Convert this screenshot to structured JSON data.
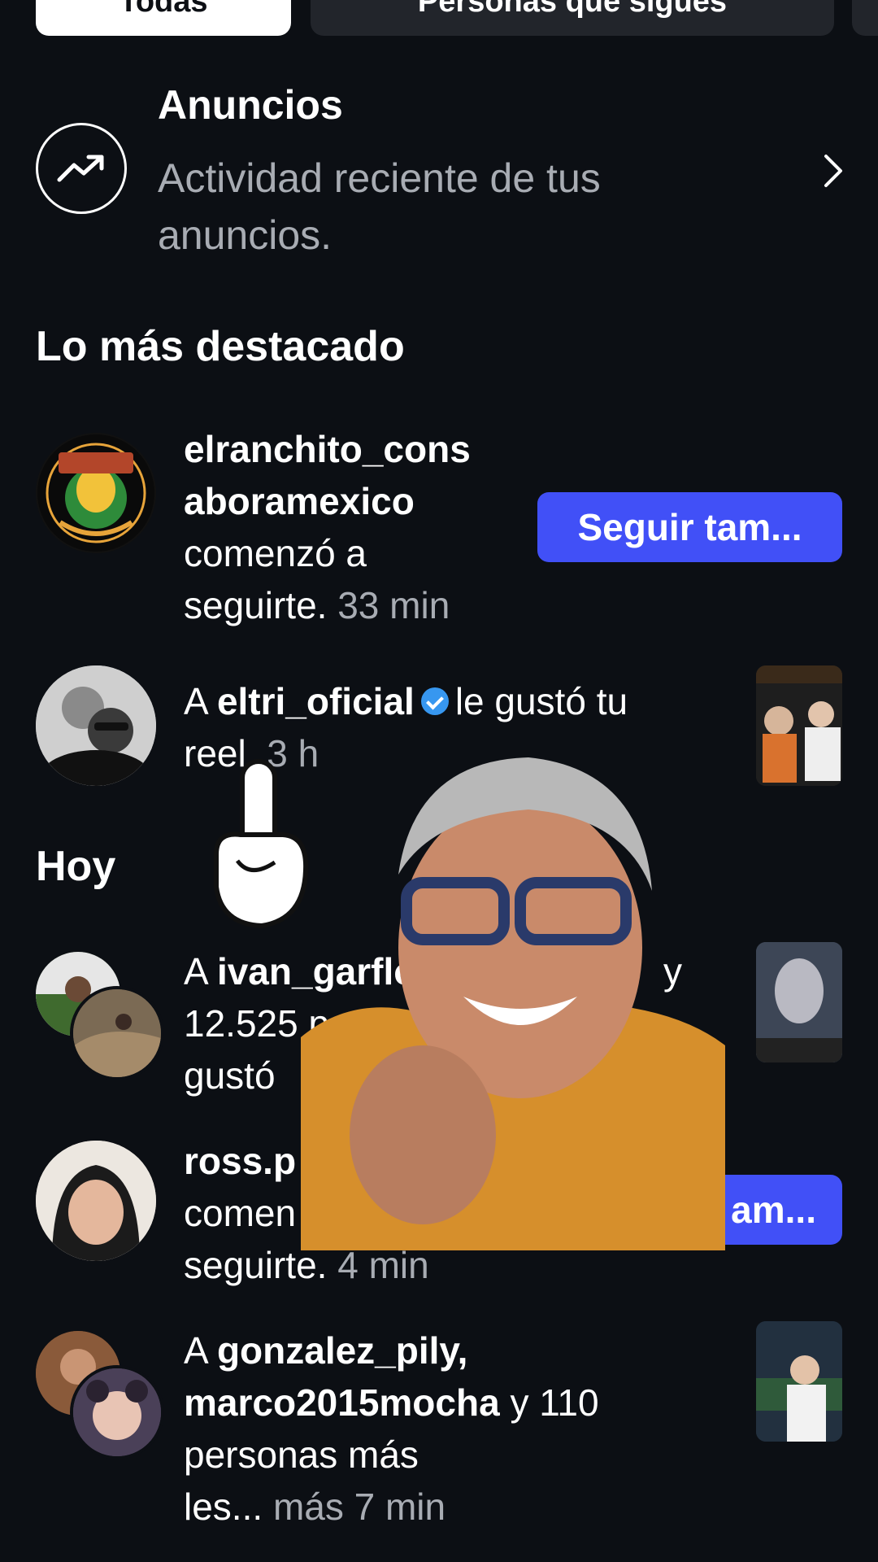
{
  "tabs": [
    {
      "label": "Todas",
      "active": true
    },
    {
      "label": "Personas que sigues",
      "active": false
    }
  ],
  "ads": {
    "title": "Anuncios",
    "subtitle": "Actividad reciente de tus anuncios.",
    "icon": "trending-up-icon"
  },
  "sections": {
    "highlights": "Lo más destacado",
    "today": "Hoy"
  },
  "notifications": [
    {
      "user": "elranchito_consaboramexico",
      "user_line1": "elranchito_cons",
      "user_line2": "aboramexico",
      "text_line1": "comenzó a",
      "text_line2": "seguirte.",
      "time": "33 min",
      "button": "Seguir tam..."
    },
    {
      "prefix": "A",
      "user": "eltri_oficial",
      "verified": true,
      "text_a": "le gustó tu",
      "text_b": "reel.",
      "time": "3 h"
    },
    {
      "prefix": "A",
      "user": "ivan_garflo",
      "line2": "12.525 pers",
      "line3": "gustó",
      "tail": "y"
    },
    {
      "user": "ross.p",
      "line2": "comen",
      "line3": "seguirte.",
      "time": "4 min",
      "button": "am..."
    },
    {
      "prefix": "A",
      "users": "gonzalez_pily,",
      "users2": "marco2015mocha",
      "count": "y 110",
      "line3": "personas más",
      "line4": "les...",
      "more": "más",
      "time": "7 min"
    }
  ],
  "colors": {
    "background": "#0c0f14",
    "accent": "#4150f7",
    "muted": "#a8acb3",
    "verified": "#3797f0"
  }
}
